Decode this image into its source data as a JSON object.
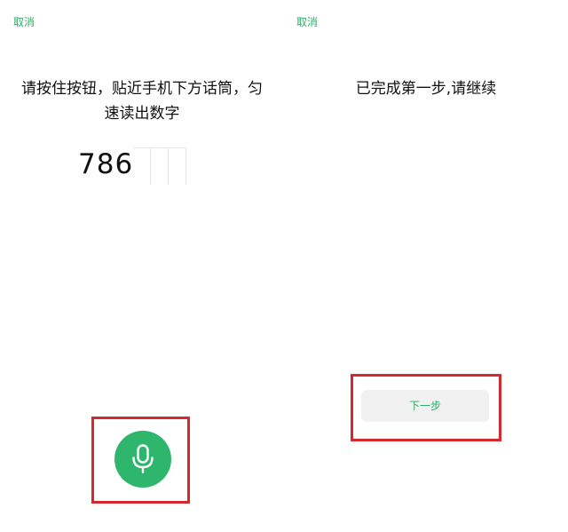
{
  "left_screen": {
    "cancel_label": "取消",
    "instruction_line1": "请按住按钮，贴近手机下方话筒，匀",
    "instruction_line2": "速读出数字",
    "digits_shown": "786",
    "mic_button": {
      "icon": "microphone-icon",
      "color": "#2db66c"
    }
  },
  "right_screen": {
    "cancel_label": "取消",
    "status_text": "已完成第一步,请继续",
    "next_button_label": "下一步"
  },
  "colors": {
    "accent_green": "#2aae67",
    "highlight_red": "#d42a2f",
    "button_bg": "#f1f1f1"
  }
}
